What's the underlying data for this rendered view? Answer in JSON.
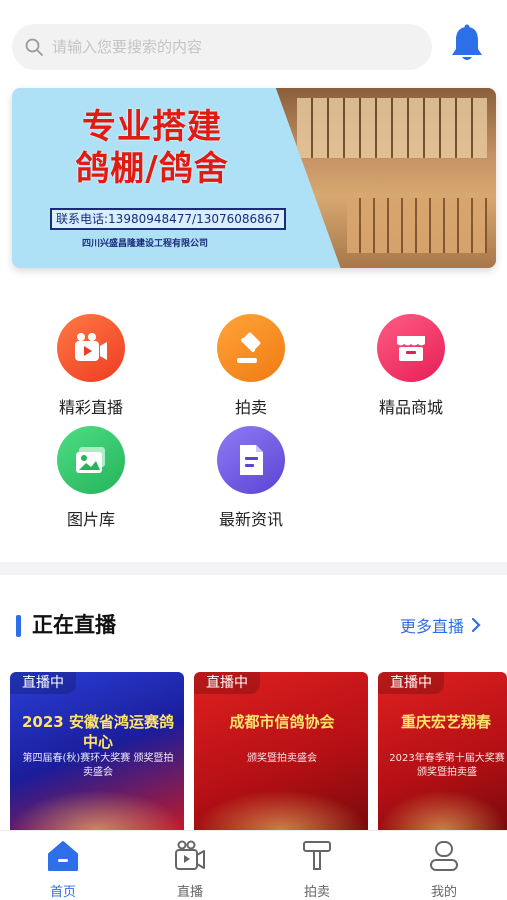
{
  "search": {
    "placeholder": "请输入您要搜索的内容"
  },
  "banner": {
    "headline_line1": "专业搭建",
    "headline_line2": "鸽棚/鸽舍",
    "phone": "联系电话:13980948477/13076086867",
    "company": "四川兴盛昌隆建设工程有限公司"
  },
  "menu": [
    {
      "label": "精彩直播",
      "icon": "video-camera-icon",
      "color": "#f2542d"
    },
    {
      "label": "拍卖",
      "icon": "gavel-icon",
      "color": "#f5871f"
    },
    {
      "label": "精品商城",
      "icon": "store-icon",
      "color": "#f0366b"
    },
    {
      "label": "图片库",
      "icon": "image-icon",
      "color": "#3cc86c"
    },
    {
      "label": "最新资讯",
      "icon": "news-icon",
      "color": "#6c5ce7"
    }
  ],
  "live": {
    "section_title": "正在直播",
    "more_label": "更多直播",
    "cards": [
      {
        "badge": "直播中",
        "title": "2023 安徽省鸿运赛鸽中心",
        "subtitle": "第四届春(秋)赛环大奖赛 颁奖暨拍卖盛会"
      },
      {
        "badge": "直播中",
        "title": "成都市信鸽协会",
        "subtitle": "颁奖暨拍卖盛会"
      },
      {
        "badge": "直播中",
        "title": "重庆宏艺翔春",
        "subtitle": "2023年春季第十届大奖赛 颁奖暨拍卖盛"
      }
    ]
  },
  "tabbar": [
    {
      "label": "首页",
      "icon": "home-icon",
      "active": true
    },
    {
      "label": "直播",
      "icon": "live-camera-icon",
      "active": false
    },
    {
      "label": "拍卖",
      "icon": "gavel-tab-icon",
      "active": false
    },
    {
      "label": "我的",
      "icon": "user-icon",
      "active": false
    }
  ],
  "colors": {
    "accent": "#2d6fe8",
    "live_badge_bg": "#e02020"
  }
}
